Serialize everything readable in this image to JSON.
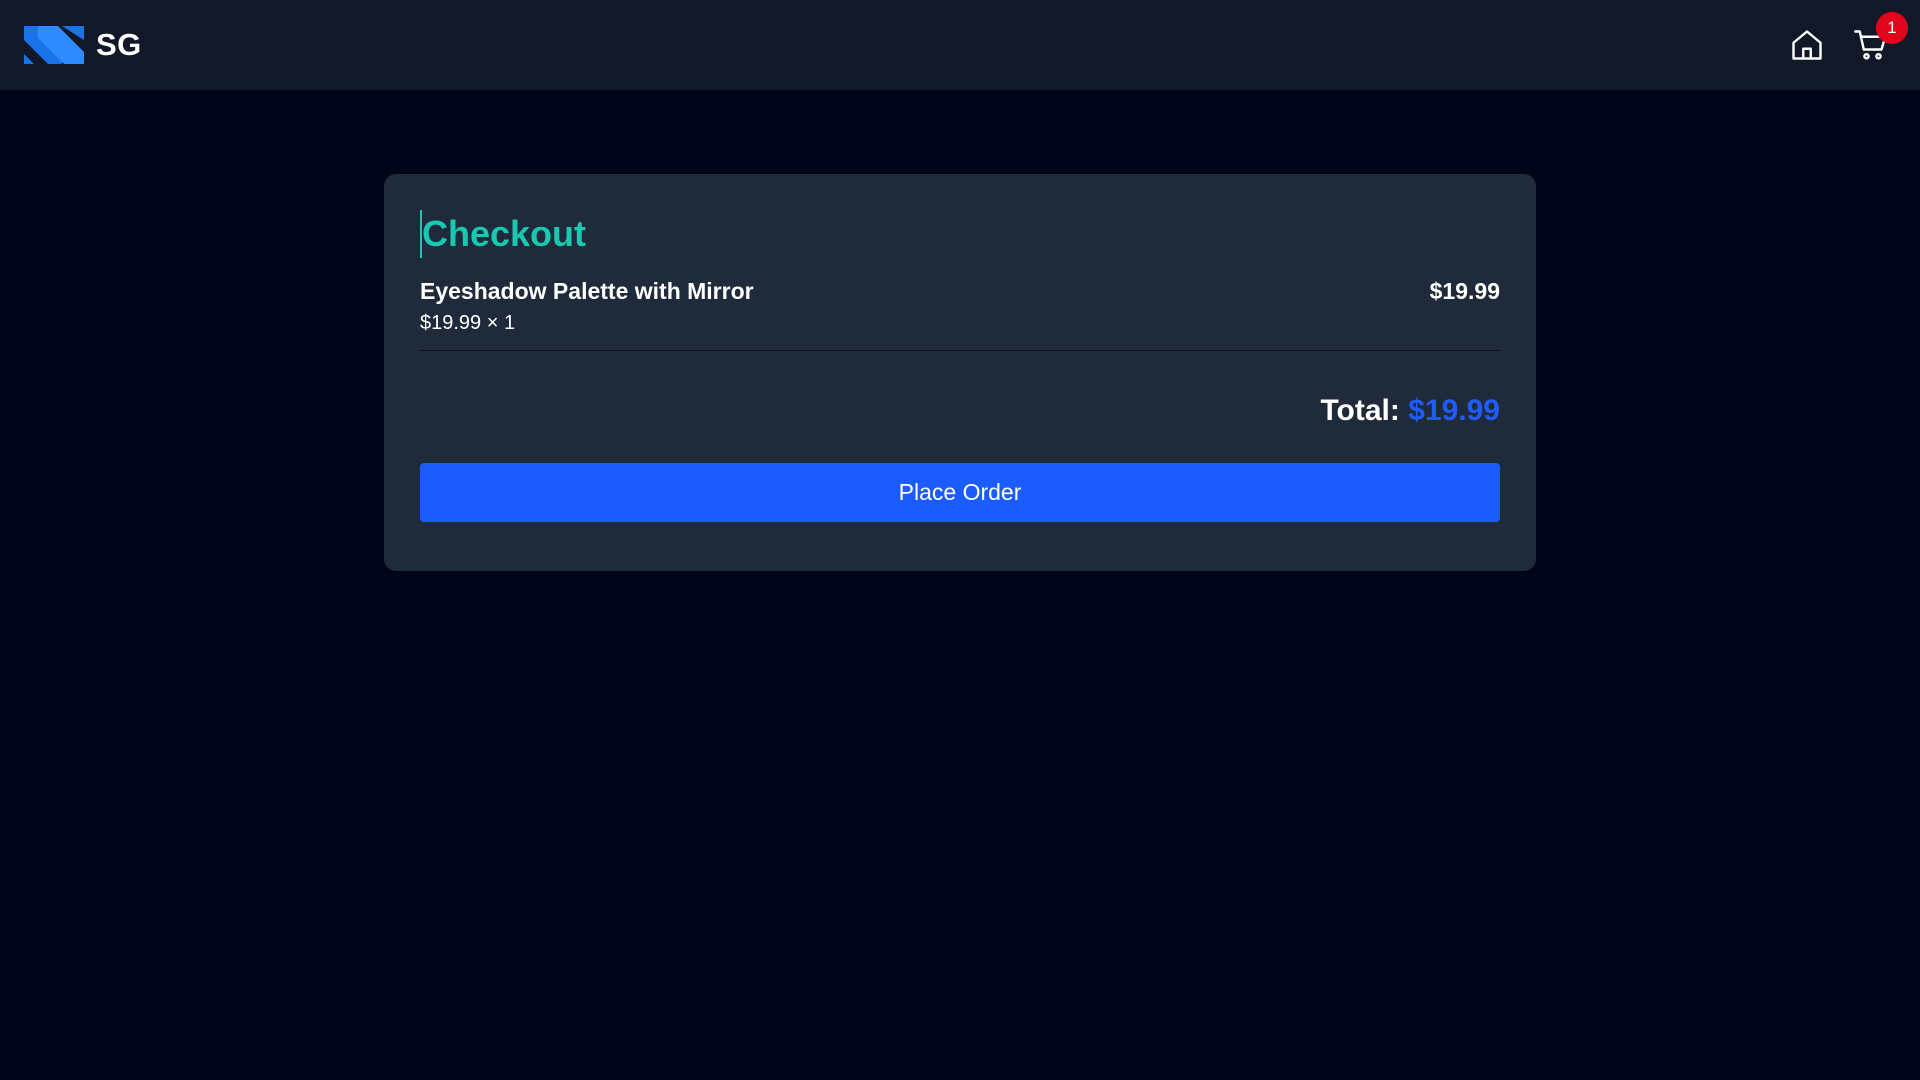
{
  "header": {
    "brand_text": "SG",
    "logo_icon": "sg-logo-icon",
    "home_icon": "home-icon",
    "cart_icon": "cart-icon",
    "cart_count": "1"
  },
  "checkout": {
    "title": "Checkout",
    "items": [
      {
        "name": "Eyeshadow Palette with Mirror",
        "unit_price": "$19.99",
        "quantity_text": "$19.99 × 1",
        "line_total": "$19.99"
      }
    ],
    "total_label": "Total:",
    "total_value": "$19.99",
    "place_order_label": "Place Order"
  },
  "colors": {
    "background": "#00051a",
    "topbar": "#111827",
    "card": "#1f2a3b",
    "title_accent": "#1ac7b0",
    "primary": "#1a5cff",
    "badge": "#e1061c"
  }
}
